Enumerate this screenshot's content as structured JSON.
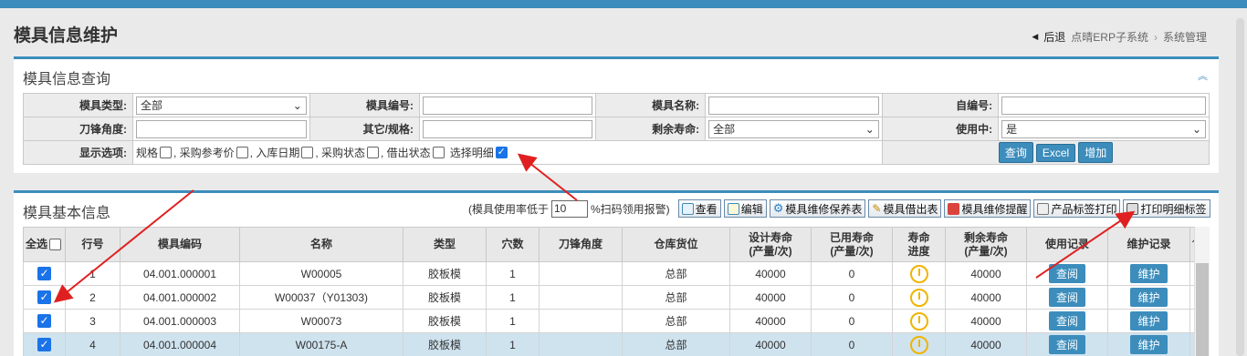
{
  "page": {
    "title": "模具信息维护"
  },
  "breadcrumb": {
    "back": "后退",
    "items": [
      "点晴ERP子系统",
      "系统管理"
    ],
    "sep": "›"
  },
  "query_panel": {
    "title": "模具信息查询",
    "collapse_icon": "chevron-up-double",
    "labels": {
      "mold_type": "模具类型:",
      "mold_code": "模具编号:",
      "mold_name": "模具名称:",
      "self_code": "自编号:",
      "blade_angle": "刀锋角度:",
      "other_spec": "其它/规格:",
      "remaining_life": "剩余寿命:",
      "in_use": "使用中:",
      "display_options": "显示选项:"
    },
    "values": {
      "mold_type": "全部",
      "remaining_life": "全部",
      "in_use": "是"
    },
    "options": [
      {
        "label": "规格",
        "checked": false
      },
      {
        "label": ", 采购参考价",
        "checked": false
      },
      {
        "label": ", 入库日期",
        "checked": false
      },
      {
        "label": ", 采购状态",
        "checked": false
      },
      {
        "label": ", 借出状态",
        "checked": false
      },
      {
        "label": "选择明细",
        "checked": true
      }
    ],
    "buttons": {
      "query": "查询",
      "excel": "Excel",
      "add": "增加"
    }
  },
  "grid_panel": {
    "title": "模具基本信息",
    "rate_prefix": "(模具使用率低于",
    "rate_value": "10",
    "rate_suffix": "%扫码领用报警)",
    "toolbar": {
      "view": "查看",
      "edit": "编辑",
      "maint_table": "模具维修保养表",
      "lend_table": "模具借出表",
      "maint_reminder": "模具维修提醒",
      "label_print": "产品标签打印",
      "detail_print": "打印明细标签"
    },
    "headers": {
      "select_all": "全选",
      "row_no": "行号",
      "code": "模具编码",
      "name": "名称",
      "type": "类型",
      "cavities": "穴数",
      "blade_angle": "刀锋角度",
      "location": "仓库货位",
      "design_life": "设计寿命\n(产量/次)",
      "used_life": "已用寿命\n(产量/次)",
      "life_progress": "寿命\n进度",
      "remaining_life": "剩余寿命\n(产量/次)",
      "usage_record": "使用记录",
      "maint_record": "维护记录"
    },
    "rows": [
      {
        "checked": true,
        "no": "1",
        "code": "04.001.000001",
        "name": "W00005",
        "type": "胶板模",
        "cavities": "1",
        "blade_angle": "",
        "location": "总部",
        "design_life": "40000",
        "used_life": "0",
        "remaining_life": "40000",
        "usage_btn": "查阅",
        "maint_btn": "维护",
        "selected": false
      },
      {
        "checked": true,
        "no": "2",
        "code": "04.001.000002",
        "name": "W00037（Y01303)",
        "type": "胶板模",
        "cavities": "1",
        "blade_angle": "",
        "location": "总部",
        "design_life": "40000",
        "used_life": "0",
        "remaining_life": "40000",
        "usage_btn": "查阅",
        "maint_btn": "维护",
        "selected": false
      },
      {
        "checked": true,
        "no": "3",
        "code": "04.001.000003",
        "name": "W00073",
        "type": "胶板模",
        "cavities": "1",
        "blade_angle": "",
        "location": "总部",
        "design_life": "40000",
        "used_life": "0",
        "remaining_life": "40000",
        "usage_btn": "查阅",
        "maint_btn": "维护",
        "selected": false
      },
      {
        "checked": true,
        "no": "4",
        "code": "04.001.000004",
        "name": "W00175-A",
        "type": "胶板模",
        "cavities": "1",
        "blade_angle": "",
        "location": "总部",
        "design_life": "40000",
        "used_life": "0",
        "remaining_life": "40000",
        "usage_btn": "查阅",
        "maint_btn": "维护",
        "selected": true
      }
    ]
  },
  "colors": {
    "accent": "#3c8dbc",
    "annotation_arrow": "#e02020",
    "progress_ring": "#f0b400"
  }
}
